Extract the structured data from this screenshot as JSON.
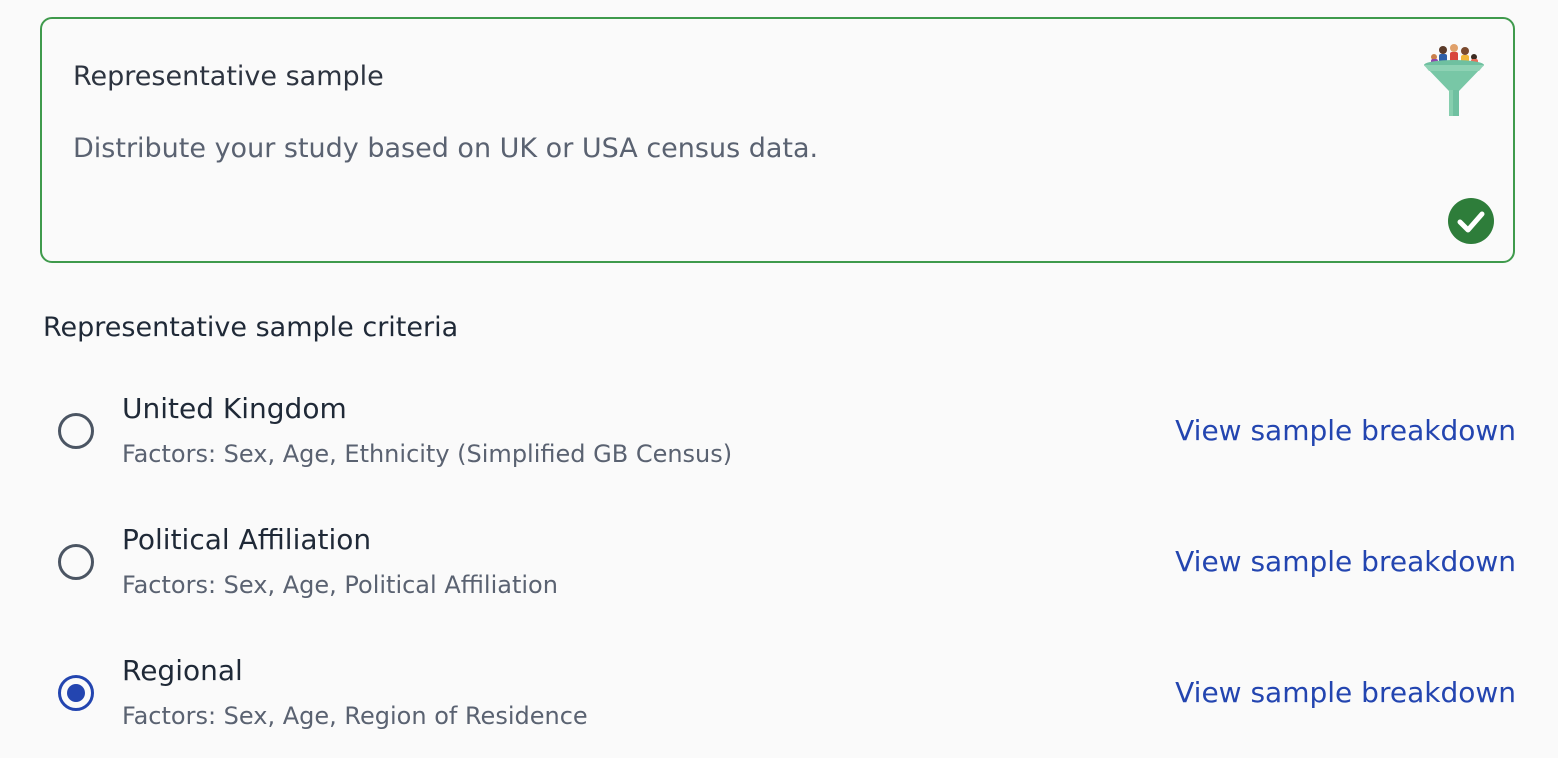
{
  "card": {
    "title": "Representative sample",
    "description": "Distribute your study based on UK or USA census data.",
    "selected": true,
    "accent_color": "#3f9a4c",
    "icon": "funnel-people-icon",
    "status_icon": "check-circle-icon"
  },
  "criteria": {
    "heading": "Representative sample criteria",
    "options": [
      {
        "label": "United Kingdom",
        "factors": "Factors: Sex, Age, Ethnicity (Simplified GB Census)",
        "link": "View sample breakdown",
        "selected": false
      },
      {
        "label": "Political Affiliation",
        "factors": "Factors: Sex, Age, Political Affiliation",
        "link": "View sample breakdown",
        "selected": false
      },
      {
        "label": "Regional",
        "factors": "Factors: Sex, Age, Region of Residence",
        "link": "View sample breakdown",
        "selected": true
      }
    ]
  },
  "colors": {
    "link": "#2345b0",
    "radio_selected": "#2345b0",
    "check": "#2e7d3a"
  }
}
